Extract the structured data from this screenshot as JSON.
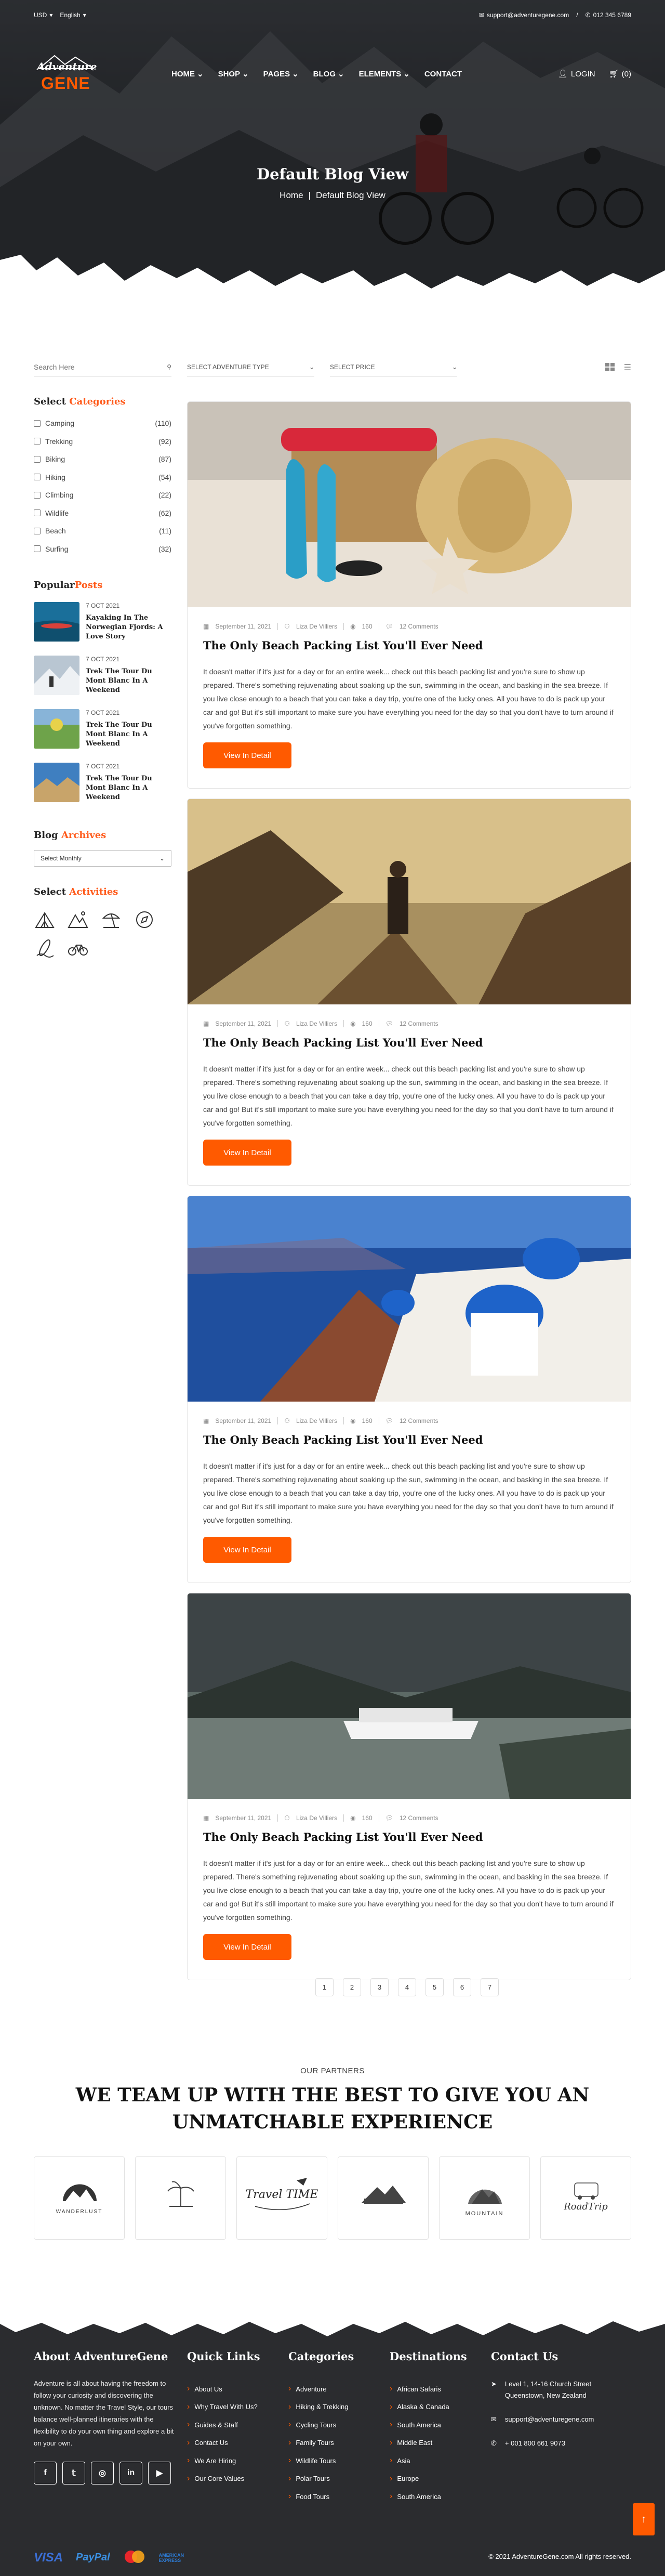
{
  "topbar": {
    "currency": "USD",
    "language": "English",
    "email": "support@adventuregene.com",
    "phone": "012 345 6789"
  },
  "brand": {
    "line1": "Adventure",
    "line2": "GENE",
    "accent": "#ff5a00"
  },
  "nav": {
    "items": [
      "HOME",
      "SHOP",
      "PAGES",
      "BLOG",
      "ELEMENTS",
      "CONTACT"
    ],
    "login": "LOGIN",
    "cart": "(0)"
  },
  "hero": {
    "title": "Default Blog View",
    "crumb_home": "Home",
    "crumb_current": "Default Blog View"
  },
  "filters": {
    "search_placeholder": "Search Here",
    "type": "SELECT ADVENTURE TYPE",
    "price": "SELECT PRICE"
  },
  "sidebar": {
    "categories_h1": "Select",
    "categories_h2": "Categories",
    "categories": [
      {
        "label": "Camping",
        "count": "(110)"
      },
      {
        "label": "Trekking",
        "count": "(92)"
      },
      {
        "label": "Biking",
        "count": "(87)"
      },
      {
        "label": "Hiking",
        "count": "(54)"
      },
      {
        "label": "Climbing",
        "count": "(22)"
      },
      {
        "label": "Wildlife",
        "count": "(62)"
      },
      {
        "label": "Beach",
        "count": "(11)"
      },
      {
        "label": "Surfing",
        "count": "(32)"
      }
    ],
    "popular_h1": "Popular",
    "popular_h2": "Posts",
    "popular": [
      {
        "date": "7 OCT 2021",
        "title": "Kayaking In The Norwegian Fjords: A Love Story"
      },
      {
        "date": "7 OCT 2021",
        "title": "Trek The Tour Du Mont Blanc In A Weekend"
      },
      {
        "date": "7 OCT 2021",
        "title": "Trek The Tour Du Mont Blanc In A Weekend"
      },
      {
        "date": "7 OCT 2021",
        "title": "Trek The Tour Du Mont Blanc In A Weekend"
      }
    ],
    "archives_h1": "Blog",
    "archives_h2": "Archives",
    "archives_select": "Select Monthly",
    "activities_h1": "Select",
    "activities_h2": "Activities",
    "activities": [
      "tent-icon",
      "mountain-icon",
      "beach-umbrella-icon",
      "compass-icon",
      "surfboard-icon",
      "bike-icon"
    ]
  },
  "posts": [
    {
      "date": "September 11, 2021",
      "author": "Liza De Villiers",
      "views": "160",
      "comments": "12 Comments",
      "title": "The Only Beach Packing List You'll Ever Need",
      "excerpt": "It doesn't matter if it's just for a day or for an entire week... check out this beach packing list and you're sure to show up prepared. There's something rejuvenating about soaking up the sun, swimming in the ocean, and basking in the sea breeze. If you live close enough to a beach that you can take a day trip, you're one of the lucky ones. All you have to do is pack up your car and go! But it's still important to make sure you have everything you need for the day so that you don't have to turn around if you've forgotten something.",
      "button": "View In Detail"
    },
    {
      "date": "September 11, 2021",
      "author": "Liza De Villiers",
      "views": "160",
      "comments": "12 Comments",
      "title": "The Only Beach Packing List You'll Ever Need",
      "excerpt": "It doesn't matter if it's just for a day or for an entire week... check out this beach packing list and you're sure to show up prepared. There's something rejuvenating about soaking up the sun, swimming in the ocean, and basking in the sea breeze. If you live close enough to a beach that you can take a day trip, you're one of the lucky ones. All you have to do is pack up your car and go! But it's still important to make sure you have everything you need for the day so that you don't have to turn around if you've forgotten something.",
      "button": "View In Detail"
    },
    {
      "date": "September 11, 2021",
      "author": "Liza De Villiers",
      "views": "160",
      "comments": "12 Comments",
      "title": "The Only Beach Packing List You'll Ever Need",
      "excerpt": "It doesn't matter if it's just for a day or for an entire week... check out this beach packing list and you're sure to show up prepared. There's something rejuvenating about soaking up the sun, swimming in the ocean, and basking in the sea breeze. If you live close enough to a beach that you can take a day trip, you're one of the lucky ones. All you have to do is pack up your car and go! But it's still important to make sure you have everything you need for the day so that you don't have to turn around if you've forgotten something.",
      "button": "View In Detail"
    },
    {
      "date": "September 11, 2021",
      "author": "Liza De Villiers",
      "views": "160",
      "comments": "12 Comments",
      "title": "The Only Beach Packing List You'll Ever Need",
      "excerpt": "It doesn't matter if it's just for a day or for an entire week... check out this beach packing list and you're sure to show up prepared. There's something rejuvenating about soaking up the sun, swimming in the ocean, and basking in the sea breeze. If you live close enough to a beach that you can take a day trip, you're one of the lucky ones. All you have to do is pack up your car and go! But it's still important to make sure you have everything you need for the day so that you don't have to turn around if you've forgotten something.",
      "button": "View In Detail"
    }
  ],
  "pagination": [
    "1",
    "2",
    "3",
    "4",
    "5",
    "6",
    "7"
  ],
  "partners": {
    "eyebrow": "OUR PARTNERS",
    "heading_l1": "WE TEAM UP WITH THE BEST TO GIVE YOU AN",
    "heading_l2": "UNMATCHABLE EXPERIENCE",
    "logos": [
      "WANDERLUST",
      "",
      "Travel TIME",
      "",
      "MOUNTAIN",
      "RoadTrip"
    ]
  },
  "footer": {
    "about_title": "About AdventureGene",
    "about_text": "Adventure is all about having the freedom to follow your curiosity and discovering the unknown. No matter the Travel Style, our tours balance well-planned itineraries with the flexibility to do your own thing and explore a bit on your own.",
    "social": [
      "f",
      "t",
      "ig",
      "in",
      "yt"
    ],
    "quick_title": "Quick Links",
    "quick": [
      "About Us",
      "Why Travel With Us?",
      "Guides & Staff",
      "Contact Us",
      "We Are Hiring",
      "Our Core Values"
    ],
    "cat_title": "Categories",
    "cats": [
      "Adventure",
      "Hiking & Trekking",
      "Cycling Tours",
      "Family Tours",
      "Wildlife Tours",
      "Polar Tours",
      "Food Tours"
    ],
    "dest_title": "Destinations",
    "dests": [
      "African Safaris",
      "Alaska & Canada",
      "South America",
      "Middle East",
      "Asia",
      "Europe",
      "South America"
    ],
    "contact_title": "Contact Us",
    "address": "Level 1, 14-16 Church Street Queenstown, New Zealand",
    "email": "support@adventuregene.com",
    "phone": "+ 001 800 661 9073",
    "payments": [
      "VISA",
      "PayPal",
      "",
      "AMERICAN EXPRESS"
    ],
    "copyright": "© 2021 AdventureGene.com All rights reserved."
  }
}
